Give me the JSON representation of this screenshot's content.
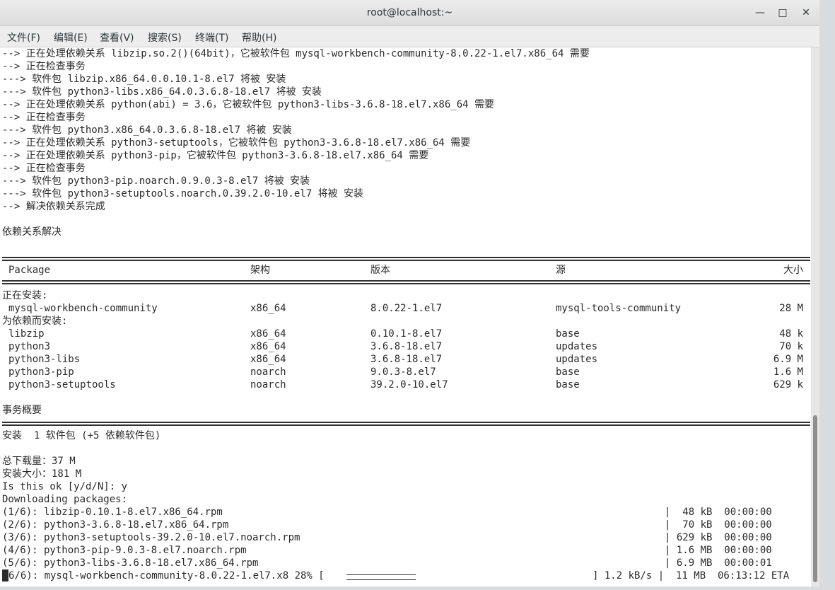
{
  "window": {
    "title": "root@localhost:~"
  },
  "menu": [
    "文件(F)",
    "编辑(E)",
    "查看(V)",
    "搜索(S)",
    "终端(T)",
    "帮助(H)"
  ],
  "terminal": {
    "lines": [
      "--> 正在处理依赖关系 libzip.so.2()(64bit)，它被软件包 mysql-workbench-community-8.0.22-1.el7.x86_64 需要",
      "--> 正在检查事务",
      "---> 软件包 libzip.x86_64.0.0.10.1-8.el7 将被 安装",
      "---> 软件包 python3-libs.x86_64.0.3.6.8-18.el7 将被 安装",
      "--> 正在处理依赖关系 python(abi) = 3.6，它被软件包 python3-libs-3.6.8-18.el7.x86_64 需要",
      "--> 正在检查事务",
      "---> 软件包 python3.x86_64.0.3.6.8-18.el7 将被 安装",
      "--> 正在处理依赖关系 python3-setuptools，它被软件包 python3-3.6.8-18.el7.x86_64 需要",
      "--> 正在处理依赖关系 python3-pip，它被软件包 python3-3.6.8-18.el7.x86_64 需要",
      "--> 正在检查事务",
      "---> 软件包 python3-pip.noarch.0.9.0.3-8.el7 将被 安装",
      "---> 软件包 python3-setuptools.noarch.0.39.2.0-10.el7 将被 安装",
      "--> 解决依赖关系完成",
      "",
      "依赖关系解决"
    ],
    "table_headers": [
      "Package",
      "架构",
      "版本",
      "源",
      "大小"
    ],
    "installing_label": "正在安装:",
    "installing": [
      [
        "mysql-workbench-community",
        "x86_64",
        "8.0.22-1.el7",
        "mysql-tools-community",
        "28 M"
      ]
    ],
    "deps_label": "为依赖而安装:",
    "deps": [
      [
        "libzip",
        "x86_64",
        "0.10.1-8.el7",
        "base",
        "48 k"
      ],
      [
        "python3",
        "x86_64",
        "3.6.8-18.el7",
        "updates",
        "70 k"
      ],
      [
        "python3-libs",
        "x86_64",
        "3.6.8-18.el7",
        "updates",
        "6.9 M"
      ],
      [
        "python3-pip",
        "noarch",
        "9.0.3-8.el7",
        "base",
        "1.6 M"
      ],
      [
        "python3-setuptools",
        "noarch",
        "39.2.0-10.el7",
        "base",
        "629 k"
      ]
    ],
    "summary_title": "事务概要",
    "summary_line": "安装  1 软件包 (+5 依赖软件包)",
    "total_download": "总下载量：37 M",
    "install_size": "安装大小：181 M",
    "prompt": "Is this ok [y/d/N]: y",
    "downloading": "Downloading packages:",
    "downloads": [
      [
        "(1/6): libzip-0.10.1-8.el7.x86_64.rpm",
        "|  48 kB  00:00:00"
      ],
      [
        "(2/6): python3-3.6.8-18.el7.x86_64.rpm",
        "|  70 kB  00:00:00"
      ],
      [
        "(3/6): python3-setuptools-39.2.0-10.el7.noarch.rpm",
        "| 629 kB  00:00:00"
      ],
      [
        "(4/6): python3-pip-9.0.3-8.el7.noarch.rpm",
        "| 1.6 MB  00:00:00"
      ],
      [
        "(5/6): python3-libs-3.6.8-18.el7.x86_64.rpm",
        "| 6.9 MB  00:00:01"
      ]
    ],
    "current_download": {
      "name": "6/6): mysql-workbench-community-8.0.22-1.el7.x8 28% [",
      "progress": 0.28,
      "tail": "] 1.2 kB/s |  11 MB  06:13:12 ETA"
    }
  }
}
